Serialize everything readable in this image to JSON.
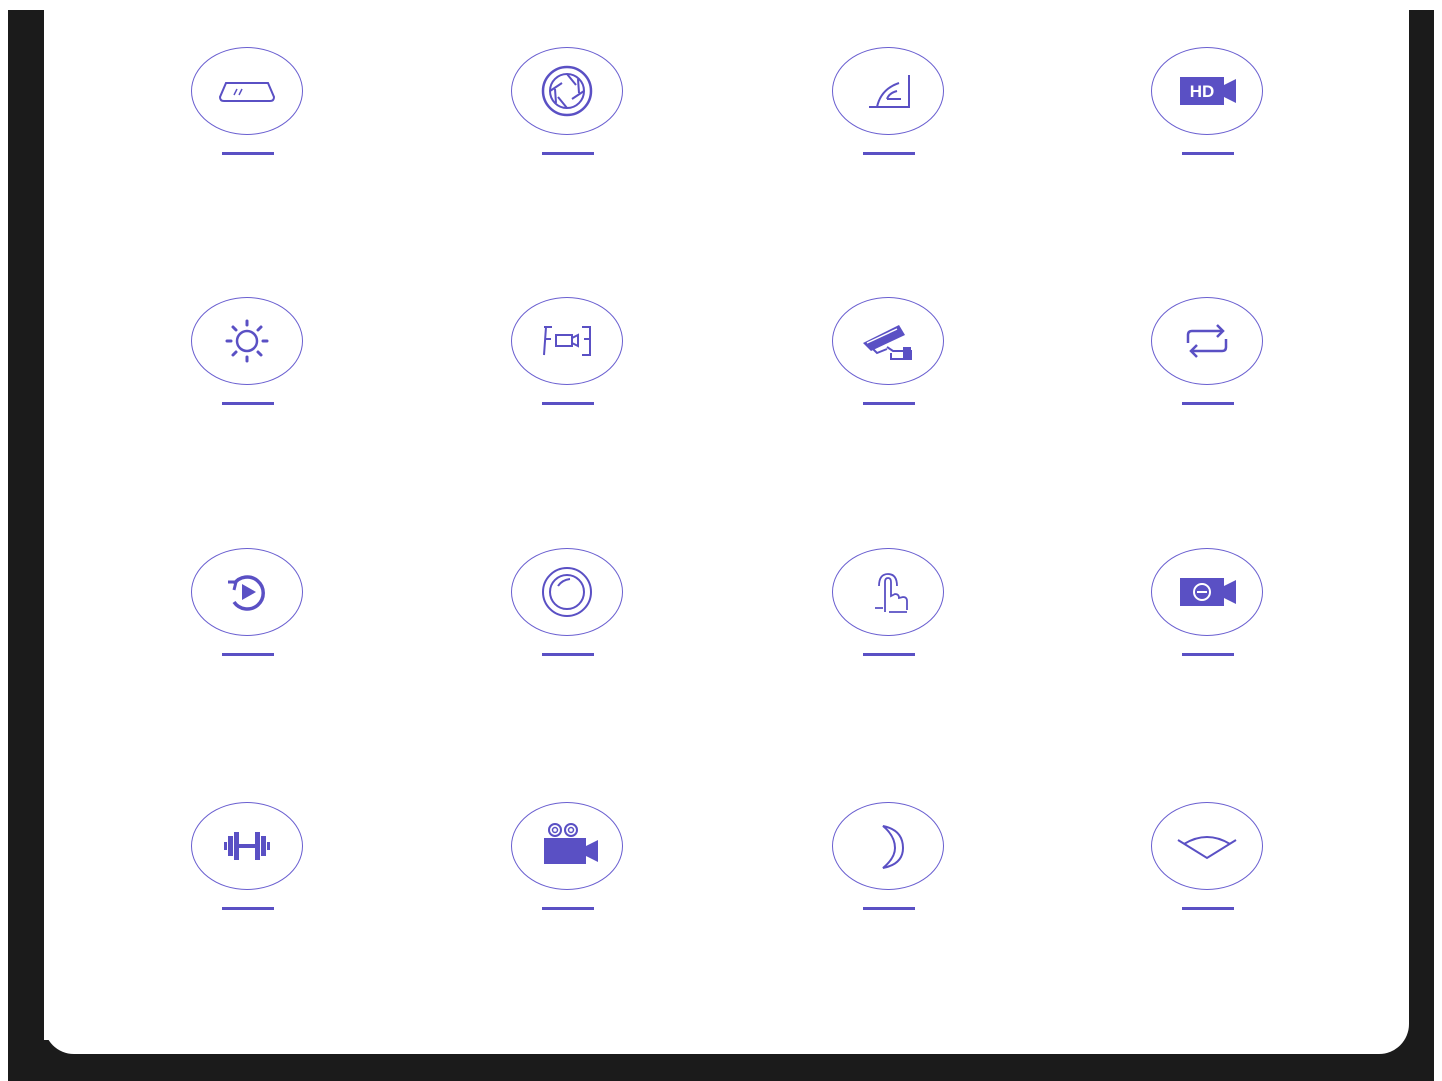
{
  "accent_color": "#5a50c4",
  "ring_color": "#6a5fd0",
  "features": [
    {
      "icon": "mirror-icon",
      "label": ""
    },
    {
      "icon": "aperture-icon",
      "label": ""
    },
    {
      "icon": "wide-angle-icon",
      "label": ""
    },
    {
      "icon": "hd-camera-icon",
      "label": ""
    },
    {
      "icon": "brightness-icon",
      "label": ""
    },
    {
      "icon": "front-rear-camera-icon",
      "label": ""
    },
    {
      "icon": "surveillance-camera-icon",
      "label": ""
    },
    {
      "icon": "loop-recording-icon",
      "label": ""
    },
    {
      "icon": "playback-icon",
      "label": ""
    },
    {
      "icon": "lens-icon",
      "label": ""
    },
    {
      "icon": "touch-screen-icon",
      "label": ""
    },
    {
      "icon": "video-record-icon",
      "label": ""
    },
    {
      "icon": "dumbbell-icon",
      "label": ""
    },
    {
      "icon": "movie-camera-icon",
      "label": ""
    },
    {
      "icon": "night-vision-icon",
      "label": ""
    },
    {
      "icon": "viewing-angle-icon",
      "label": ""
    }
  ]
}
